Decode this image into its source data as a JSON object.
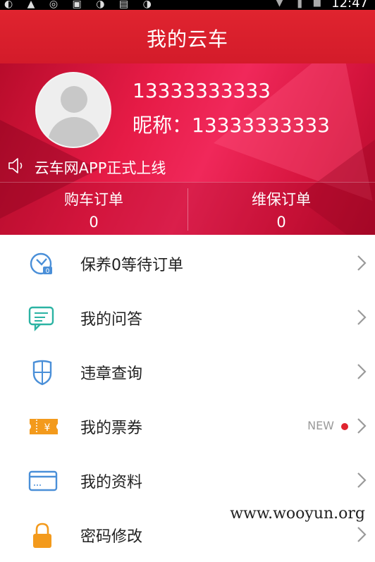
{
  "status_bar": {
    "time": "12:47",
    "left_icons": "◐ ▲ ◎ ▣ ◑ ▤ ◑",
    "right_icons": "▼ ▐ ■"
  },
  "header": {
    "title": "我的云车"
  },
  "profile": {
    "phone": "13333333333",
    "nickname": "昵称：13333333333",
    "notice": "云车网APP正式上线"
  },
  "orders": [
    {
      "label": "购车订单",
      "count": "0"
    },
    {
      "label": "维保订单",
      "count": "0"
    }
  ],
  "menu": [
    {
      "label": "保养0等待订单",
      "icon": "maintenance-clock-icon"
    },
    {
      "label": "我的问答",
      "icon": "chat-bubble-icon"
    },
    {
      "label": "违章查询",
      "icon": "shield-icon"
    },
    {
      "label": "我的票券",
      "icon": "ticket-icon",
      "badge": "NEW"
    },
    {
      "label": "我的资料",
      "icon": "card-icon"
    },
    {
      "label": "密码修改",
      "icon": "lock-icon"
    }
  ],
  "colors": {
    "brand_red": "#d81e2e",
    "icon_blue": "#4a8fd8",
    "icon_teal": "#2bb3a3",
    "icon_orange": "#f39a1c"
  },
  "watermark": "www.wooyun.org"
}
